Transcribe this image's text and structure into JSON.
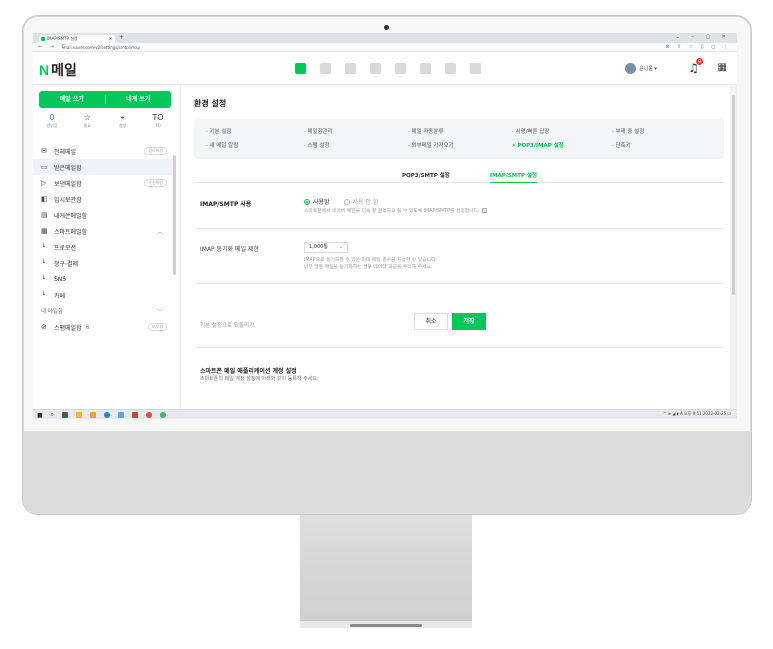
{
  "browser": {
    "tab_title": "IMAP/SMTP 설정",
    "tab_new": "+",
    "window_controls": "⌄ – ▢ ✕",
    "nav": "← → C",
    "url": "mail.naver.com/v2/settings/smtp/imap",
    "addr_icons": "⊕ ⇪ ☆ ▯ ◻ ⋮"
  },
  "header": {
    "logo_n": "N",
    "logo_text": "메일",
    "user_name": "윤나윤 ▾",
    "notif_count": "9",
    "bell": "♫"
  },
  "sidebar": {
    "compose": "메일 쓰기",
    "compose_self": "내게 쓰기",
    "quick": [
      {
        "top": "0",
        "label": "안읽음"
      },
      {
        "top": "☆",
        "label": "중요"
      },
      {
        "top": "⌁",
        "label": "첨부"
      },
      {
        "top": "TO",
        "label": "TO"
      }
    ],
    "folders": [
      {
        "icon": "✉",
        "label": "전체메일",
        "action": "정리하기"
      },
      {
        "icon": "▭",
        "label": "받은메일함",
        "selected": true
      },
      {
        "icon": "▷",
        "label": "보낸메일함",
        "action": "수신확인"
      },
      {
        "icon": "◧",
        "label": "임시보관함"
      },
      {
        "icon": "▤",
        "label": "내게쓴메일함"
      },
      {
        "icon": "▦",
        "label": "스마트메일함",
        "chevron": "︿"
      },
      {
        "icon": "└",
        "label": "프로모션"
      },
      {
        "icon": "└",
        "label": "청구·결제"
      },
      {
        "icon": "└",
        "label": "SNS"
      },
      {
        "icon": "└",
        "label": "카페"
      },
      {
        "icon": "",
        "label": "내 메일함",
        "chevron": "﹀",
        "head": true
      },
      {
        "icon": "⊘",
        "label": "스팸메일함",
        "sub": "6",
        "action": "비우기"
      }
    ]
  },
  "main": {
    "title": "환경 설정",
    "menu": [
      {
        "label": "· 기본 설정"
      },
      {
        "label": "· 메일함관리"
      },
      {
        "label": "· 메일 자동분류"
      },
      {
        "label": "· 서명/빠른 답장"
      },
      {
        "label": "· 부재 중 설정"
      },
      {
        "label": "· 새 메일 알림"
      },
      {
        "label": "· 스팸 설정"
      },
      {
        "label": "· 외부메일 가져오기"
      },
      {
        "label": "• POP3/IMAP 설정",
        "active": true
      },
      {
        "label": "· 단축키"
      }
    ],
    "subtabs": [
      {
        "label": "POP3/SMTP 설정"
      },
      {
        "label": "IMAP/SMTP 설정",
        "active": true
      }
    ],
    "imap_label": "IMAP/SMTP 사용",
    "radio_on": "사용함",
    "radio_off": "사용 안 함",
    "imap_desc": "스마트폰에서 네이버 메일을 더욱 잘 관리하고 쓸 수 있도록 IMAP/SMTP를 설정합니다.",
    "help": "?",
    "sync_label": "IMAP 동기화 메일 제한",
    "sync_value": "1,000통",
    "sync_caret": "⌄",
    "sync_desc1": "IMAP으로 동기화할 수 있는 최대 메일 총수를 지정할 수 있습니다.",
    "sync_desc2": "너무 많은 메일을 동기화하는 경우 데이터 과금을 주의해 주세요.",
    "reset": "기본 설정으로 되돌리기",
    "cancel": "취소",
    "save": "저장",
    "mobile_title": "스마트폰 메일 애플리케이션 계정 설정",
    "mobile_desc": "스마트폰의 메일 계정 설정에 아래와 같이 등록해 주세요."
  },
  "taskbar": {
    "start": "■",
    "search": "⌕",
    "tray": "^ ⊕ ◢ ◖ A  오후 9:51  2022-02-25  ☐"
  },
  "colors": {
    "brand": "#03c75a",
    "accent_blue": "#2a6ee0"
  }
}
